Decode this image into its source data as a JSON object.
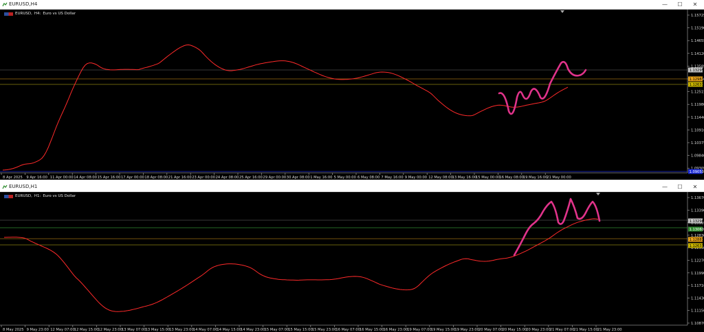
{
  "windows": [
    {
      "title": "EURUSD,H4",
      "symbol": "EURUSD,",
      "timeframe": "H4:",
      "description": "Euro vs US Dollar",
      "price_labels": [
        "1.15725",
        "1.15190",
        "1.14655",
        "1.14120",
        "1.13585",
        "1.13050",
        "1.12515",
        "1.11980",
        "1.11446",
        "1.10910",
        "1.10375",
        "1.09840",
        "1.09305"
      ],
      "badges": [
        {
          "text": "1.13295",
          "color": "#c8c8c8",
          "fg": "#000000"
        },
        {
          "text": "1.12983",
          "color": "#e8a21a",
          "fg": "#000000"
        },
        {
          "text": "1.12633",
          "color": "#c9b400",
          "fg": "#000000"
        },
        {
          "text": "1.09050",
          "color": "#1c2bd6",
          "fg": "#ffffff"
        }
      ],
      "time_labels": [
        "8 Apr 2025",
        "9 Apr 16:00",
        "11 Apr 00:00",
        "14 Apr 08:00",
        "15 Apr 16:00",
        "17 Apr 00:00",
        "18 Apr 08:00",
        "21 Apr 16:00",
        "23 Apr 00:00",
        "24 Apr 08:00",
        "25 Apr 16:00",
        "29 Apr 00:00",
        "30 Apr 08:00",
        "1 May 16:00",
        "5 May 00:00",
        "6 May 08:00",
        "7 May 16:00",
        "9 May 00:00",
        "12 May 08:00",
        "13 May 16:00",
        "15 May 00:00",
        "16 May 08:00",
        "19 May 16:00",
        "21 May 00:00"
      ]
    },
    {
      "title": "EURUSD,H1",
      "symbol": "EURUSD,",
      "timeframe": "H1:",
      "description": "Euro vs US Dollar",
      "price_labels": [
        "1.13670",
        "1.13390",
        "1.13110",
        "1.12830",
        "1.12550",
        "1.12270",
        "1.11990",
        "1.11710",
        "1.11430",
        "1.11150",
        "1.10870"
      ],
      "badges": [
        {
          "text": "1.13296",
          "color": "#c8c8c8",
          "fg": "#000000"
        },
        {
          "text": "1.13060",
          "color": "#2f8a2f",
          "fg": "#ffffff"
        },
        {
          "text": "1.12883",
          "color": "#e8a21a",
          "fg": "#000000"
        },
        {
          "text": "1.12633",
          "color": "#c9b400",
          "fg": "#000000"
        }
      ],
      "time_labels": [
        "8 May 2025",
        "9 May 23:00",
        "12 May 07:00",
        "12 May 15:00",
        "12 May 23:00",
        "13 May 07:00",
        "13 May 15:00",
        "13 May 23:00",
        "14 May 07:00",
        "14 May 15:00",
        "14 May 23:00",
        "15 May 07:00",
        "15 May 15:00",
        "15 May 23:00",
        "16 May 07:00",
        "16 May 15:00",
        "16 May 23:00",
        "19 May 07:00",
        "19 May 15:00",
        "19 May 23:00",
        "20 May 07:00",
        "20 May 15:00",
        "20 May 23:00",
        "21 May 07:00",
        "21 May 15:00",
        "21 May 23:00"
      ]
    }
  ],
  "window_buttons": {
    "minimize": "—",
    "maximize": "☐",
    "close": "✕"
  },
  "colors": {
    "bull": "#00ff00",
    "bear": "#ffffff",
    "ma": "#ff2a2a",
    "drawing": "#e0338a",
    "grid_line": "#555555"
  }
}
